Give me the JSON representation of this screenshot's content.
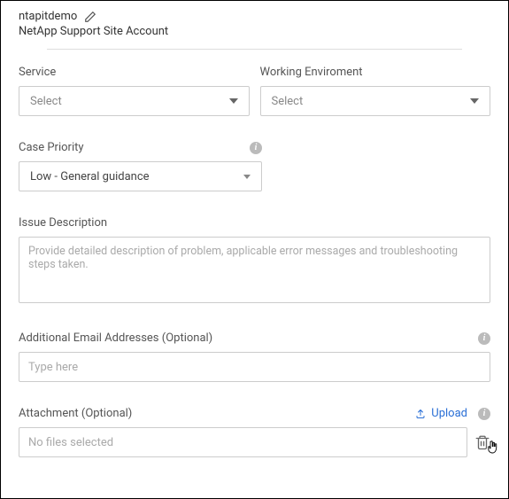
{
  "header": {
    "account_name": "ntapitdemo",
    "account_sub": "NetApp Support Site Account"
  },
  "fields": {
    "service": {
      "label": "Service",
      "placeholder": "Select"
    },
    "environment": {
      "label": "Working Enviroment",
      "placeholder": "Select"
    },
    "priority": {
      "label": "Case Priority",
      "value": "Low - General guidance"
    },
    "issue": {
      "label": "Issue Description",
      "placeholder": "Provide detailed description of problem, applicable error messages and troubleshooting steps taken."
    },
    "emails": {
      "label": "Additional Email Addresses (Optional)",
      "placeholder": "Type here"
    },
    "attachment": {
      "label": "Attachment (Optional)",
      "upload_label": "Upload",
      "empty_text": "No files selected"
    }
  }
}
